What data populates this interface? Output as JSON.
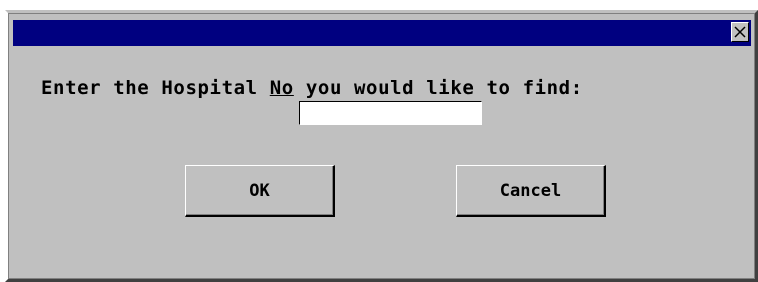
{
  "dialog": {
    "title": "",
    "close_icon": "close-x-icon",
    "prompt_part1": "Enter the Hospital ",
    "prompt_underlined": "No",
    "prompt_part2": " you would like to find:",
    "input_value": "",
    "ok_label": "OK",
    "cancel_label": "Cancel"
  },
  "colors": {
    "titlebar": "#000080",
    "dialog_bg": "#c0c0c0",
    "input_bg": "#ffffff"
  }
}
